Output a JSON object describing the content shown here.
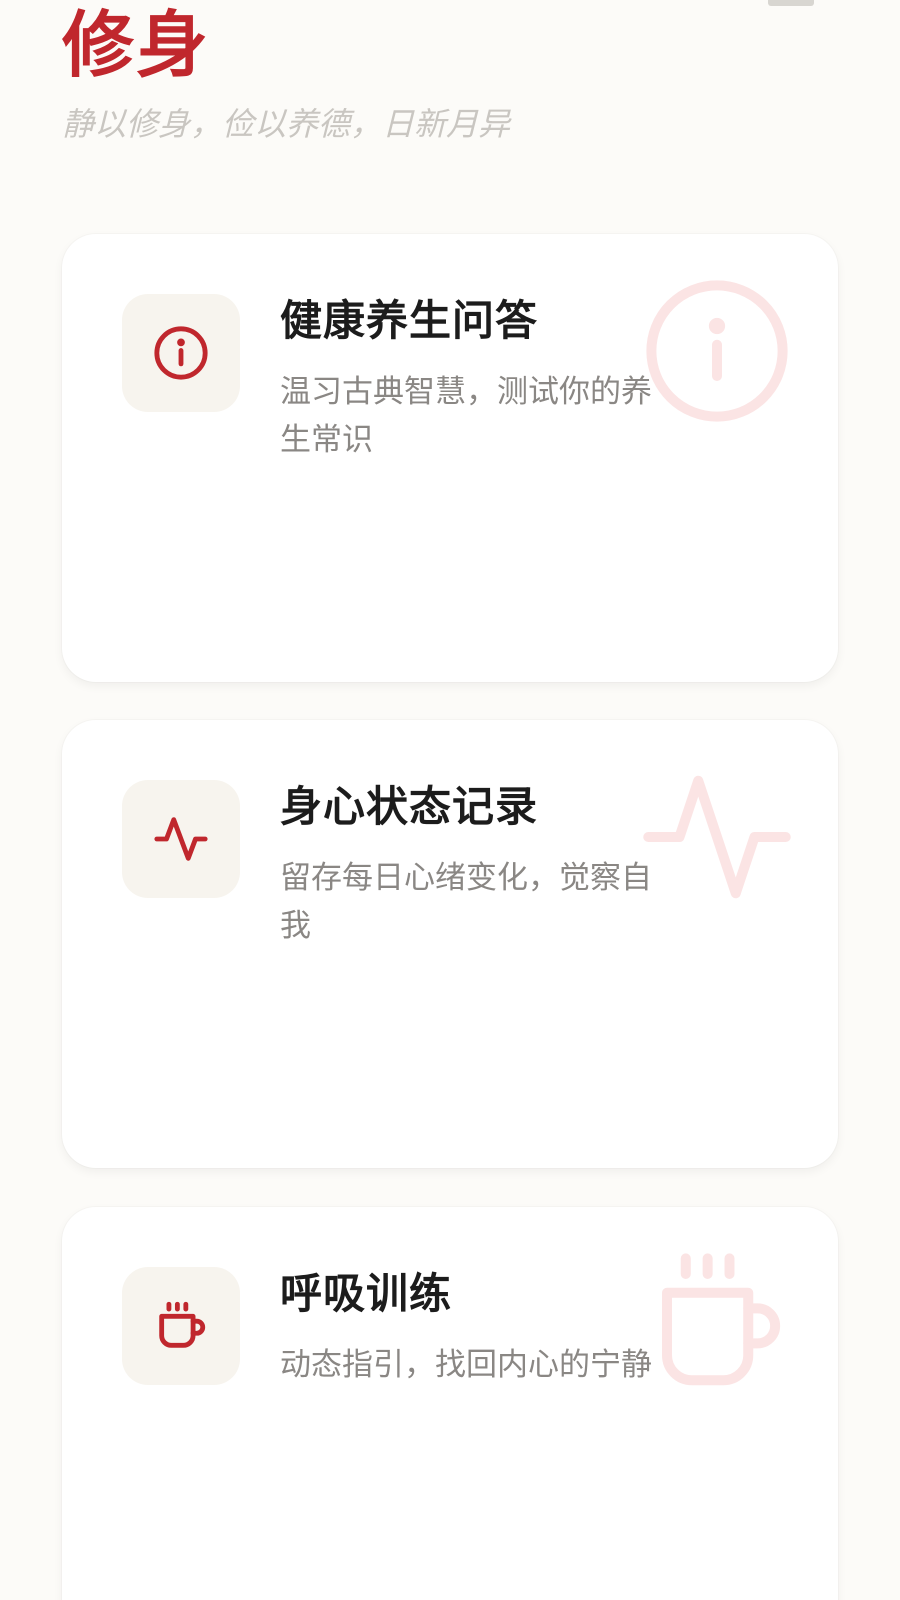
{
  "header": {
    "title": "修身",
    "subtitle": "静以修身，俭以养德，日新月异"
  },
  "cards": [
    {
      "title": "健康养生问答",
      "description": "温习古典智慧，测试你的养生常识",
      "icon": "info-circle-icon"
    },
    {
      "title": "身心状态记录",
      "description": "留存每日心绪变化，觉察自我",
      "icon": "pulse-icon"
    },
    {
      "title": "呼吸训练",
      "description": "动态指引，找回内心的宁静",
      "icon": "coffee-cup-icon"
    }
  ],
  "colors": {
    "accent": "#c0272d",
    "watermark": "#fbe4e4",
    "icon_bg": "#f7f4ee",
    "background": "#fcfbf8"
  }
}
